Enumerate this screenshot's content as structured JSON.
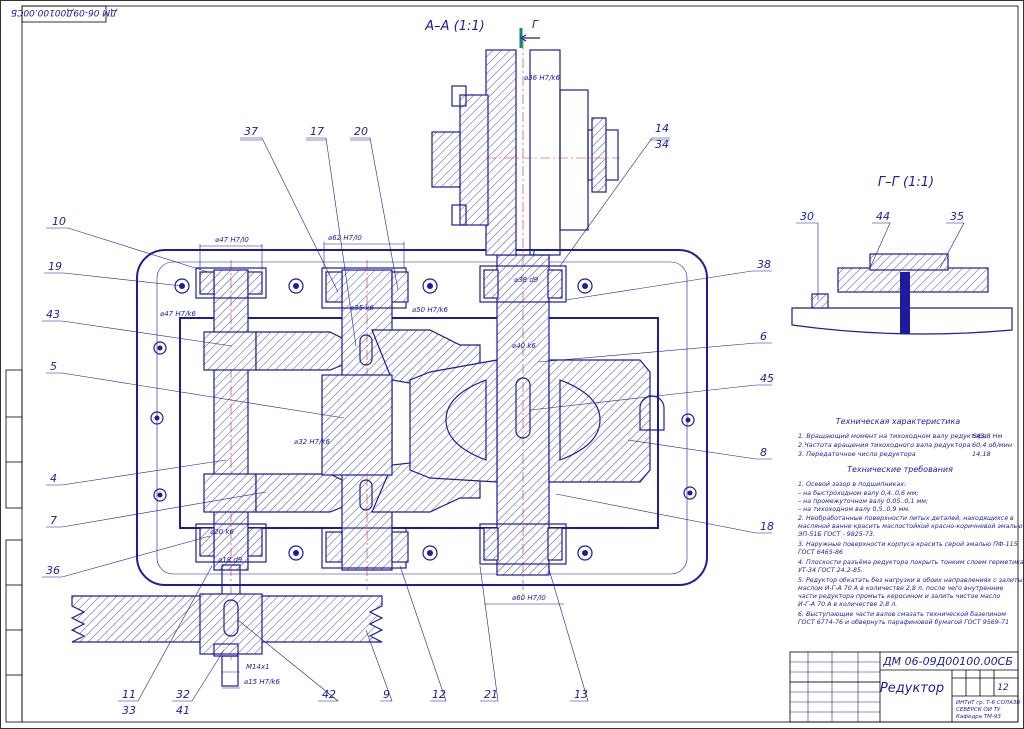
{
  "drawing": {
    "corner_code": "ДМ 06-09Д00100.00СБ",
    "section_aa": "А–А (1:1)",
    "section_gg": "Г–Г (1:1)",
    "section_mark": "Г"
  },
  "callouts": [
    "10",
    "19",
    "43",
    "5",
    "4",
    "7",
    "36",
    "11",
    "33",
    "32",
    "41",
    "42",
    "9",
    "12",
    "21",
    "13",
    "37",
    "17",
    "20",
    "14",
    "34",
    "38",
    "6",
    "45",
    "8",
    "18",
    "30",
    "44",
    "35"
  ],
  "dimensions": [
    "⌀47 H7/l0",
    "⌀62 H7/l0",
    "⌀36 H7/k6",
    "⌀38 d9",
    "⌀47 H7/k6",
    "⌀35 k6",
    "⌀50 H7/k6",
    "⌀32 H7/k6",
    "⌀20 k6",
    "⌀18 d9",
    "⌀40 k6",
    "⌀60 H7/l0",
    "⌀15 H7/k6",
    "М14х1"
  ],
  "tech_char": {
    "title": "Техническая характеристика",
    "items": [
      {
        "label": "1. Вращающий момент на тихоходном валу редуктора",
        "value": "643,8 Нм"
      },
      {
        "label": "2.Частота вращения тихоходного вала редуктора",
        "value": "60,4 об/мин"
      },
      {
        "label": "3. Передаточное число редуктора",
        "value": "14,18"
      }
    ]
  },
  "tech_req": {
    "title": "Технические требования",
    "lines": [
      "1. Осевой зазор в подшипниках:",
      "– на быстроходном валу                         0,4..0,6 мм;",
      "– на промежуточном валу                       0,05..0,1 мм;",
      "– на тихоходном валу                            0,5..0,9 мм.",
      "2. Необработанные поверхности литых деталей, находящихся в",
      "масляной ванне красить маслостойкой красно-коричневой эмалью",
      "ЭП-51Б ГОСТ - 9825-73.",
      "3. Наружные поверхности корпуса красить серой эмалью ПФ-115",
      "ГОСТ 6465-86",
      "4. Плоскости разъёма редуктора покрыть тонким слоем герметика",
      "УТ-34 ГОСТ 24.2-85.",
      "5. Редуктор обкатать без нагрузки в обоих направлениях с залитым",
      "маслом И-Г-А 70 А в количестве 2,8 л. после чего внутренние",
      "части редуктора промыть керосином и залить чистое масло",
      "И-Г-А 70 А в количестве 2,8 л.",
      "6. Выступающие части валов смазать технической базелином",
      "ГОСТ 6774-76 и обвернуть парафиновой бумагой ГОСТ 9569-71"
    ]
  },
  "title_block": {
    "doc_code": "ДМ 06-09Д00100.00СБ",
    "name": "Редуктор",
    "sheet": "12",
    "org_lines": [
      "ИНТиТ гр. Т-6 СОЛАЗВ",
      "СЕВЕРСК ОИ ТУ",
      "Кафедра ТМ-93"
    ]
  }
}
